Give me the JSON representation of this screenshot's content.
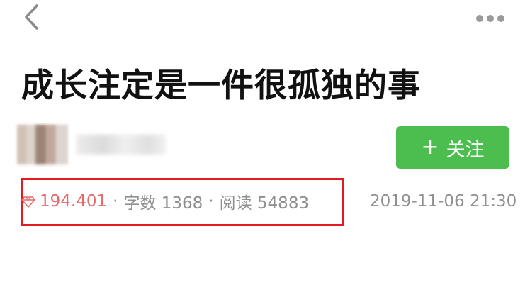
{
  "article": {
    "title": "成长注定是一件很孤独的事"
  },
  "author": {
    "name": "",
    "follow_label": "关注"
  },
  "stats": {
    "gem_value": "194.401",
    "separator": "·",
    "word_count_label": "字数 1368",
    "read_count_label": "阅读 54883"
  },
  "meta": {
    "date": "2019-11-06 21:30"
  },
  "colors": {
    "accent_green": "#4cbd4f",
    "highlight_red": "#e11b22",
    "gem_pink": "#e46a6a"
  }
}
